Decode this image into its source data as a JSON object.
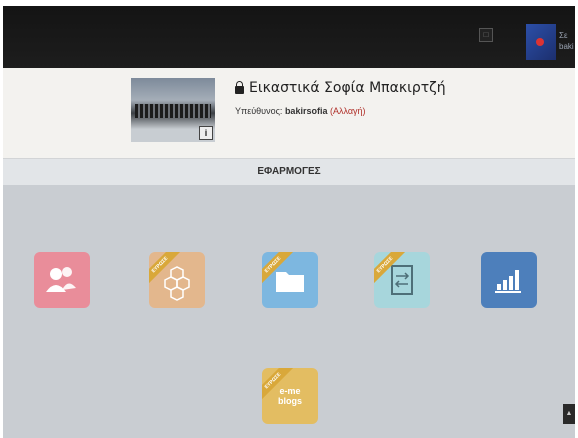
{
  "topbar": {
    "user_name_preview": "Σε\nbaki"
  },
  "course": {
    "title": "Εικαστικά Σοφία Μπακιρτζή",
    "responsible_label": "Υπεύθυνος:",
    "responsible_user": "bakirsofia",
    "change_label": "(Αλλαγή)",
    "info_label": "i"
  },
  "apps_section": {
    "title": "ΕΦΑΡΜΟΓΕΣ"
  },
  "apps": {
    "badge_label": "ΕΥΡΩΣΕ",
    "users_label": "",
    "team_label": "",
    "files_label": "",
    "exchange_label": "",
    "stats_label": "",
    "blogs_label": "e-me\nblogs"
  },
  "colors": {
    "accent_red": "#b0302a",
    "users": "#e98d9a",
    "team": "#e3b78d",
    "files": "#7db7e0",
    "exchange": "#a7d6dc",
    "stats": "#4d7fbb",
    "blogs": "#e3bd62"
  }
}
